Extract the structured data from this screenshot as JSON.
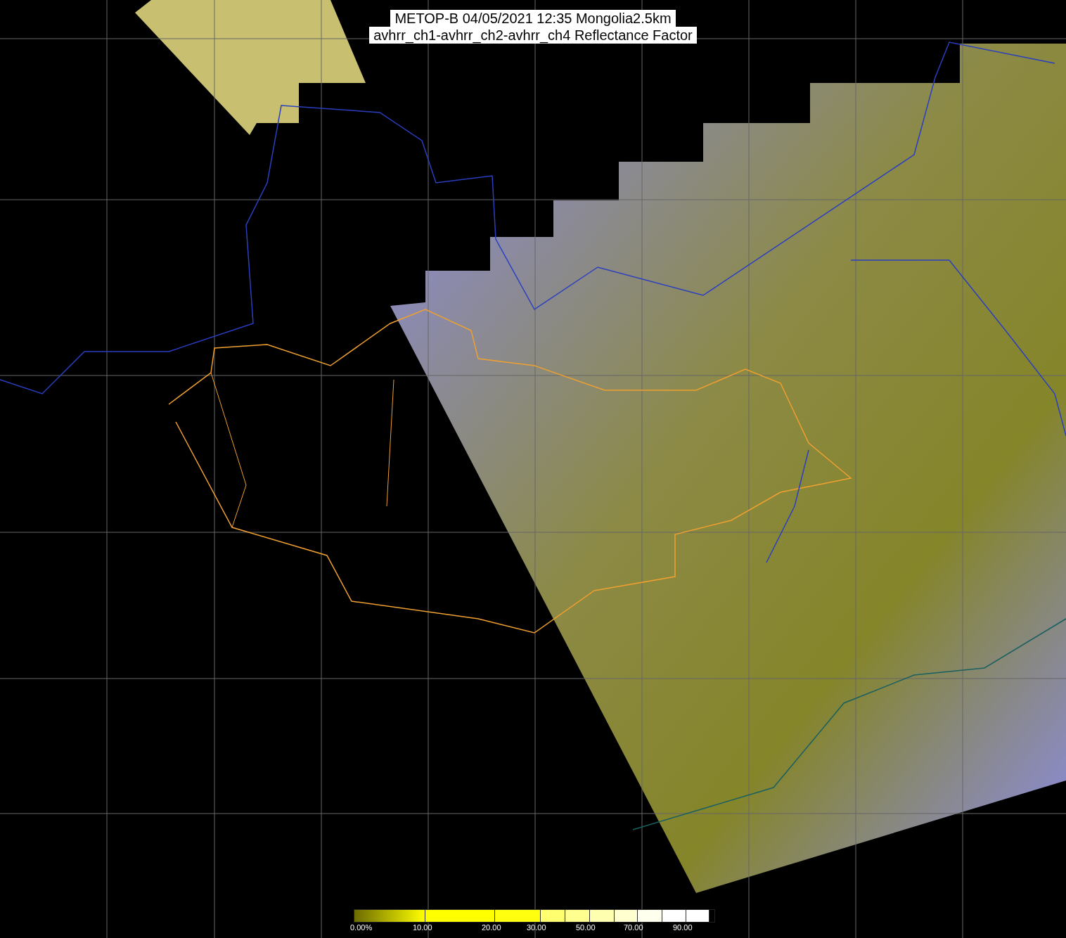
{
  "title": {
    "lines": [
      "METOP-B 04/05/2021 12:35 Mongolia2.5km",
      "avhrr_ch1-avhrr_ch2-avhrr_ch4 Reflectance Factor"
    ]
  },
  "colorbar": {
    "labels": [
      "0.00%",
      "10.00",
      "20.00",
      "30.00",
      "50.00",
      "70.00",
      "90.00"
    ]
  }
}
